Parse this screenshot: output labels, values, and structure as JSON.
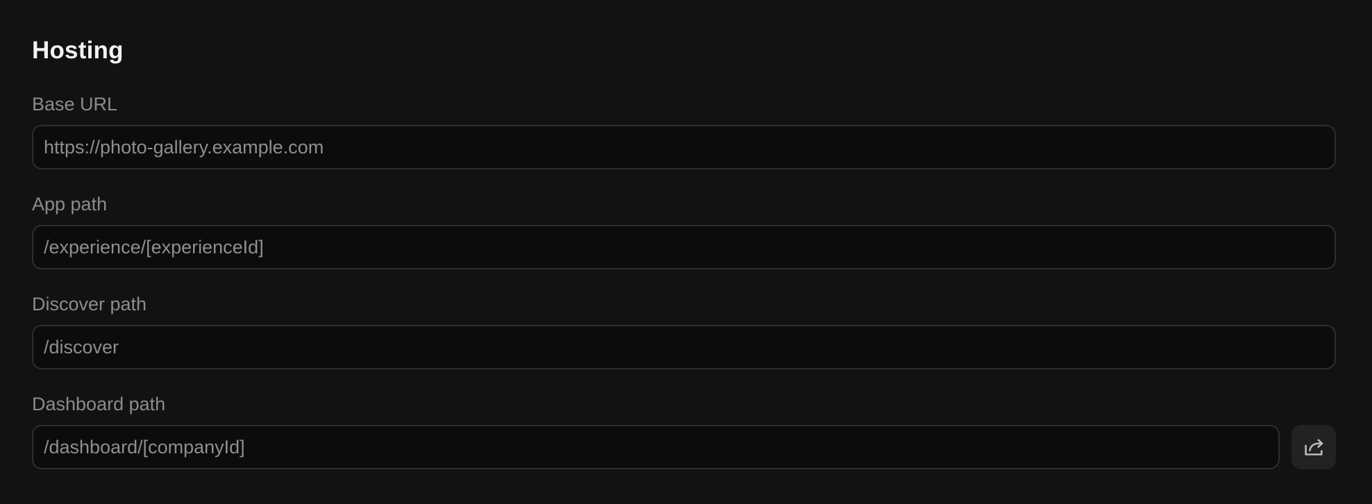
{
  "section": {
    "title": "Hosting"
  },
  "fields": {
    "base_url": {
      "label": "Base URL",
      "value": "https://photo-gallery.example.com"
    },
    "app_path": {
      "label": "App path",
      "value": "/experience/[experienceId]"
    },
    "discover_path": {
      "label": "Discover path",
      "value": "/discover"
    },
    "dashboard_path": {
      "label": "Dashboard path",
      "value": "/dashboard/[companyId]",
      "action_icon": "share-out-icon"
    }
  },
  "colors": {
    "background": "#121212",
    "input_background": "#0c0c0c",
    "input_border": "#2e2e2e",
    "title_text": "#f2f2f2",
    "label_text": "#8c8c8c",
    "input_text": "#8f8f8f",
    "icon_button_background": "#222222"
  }
}
